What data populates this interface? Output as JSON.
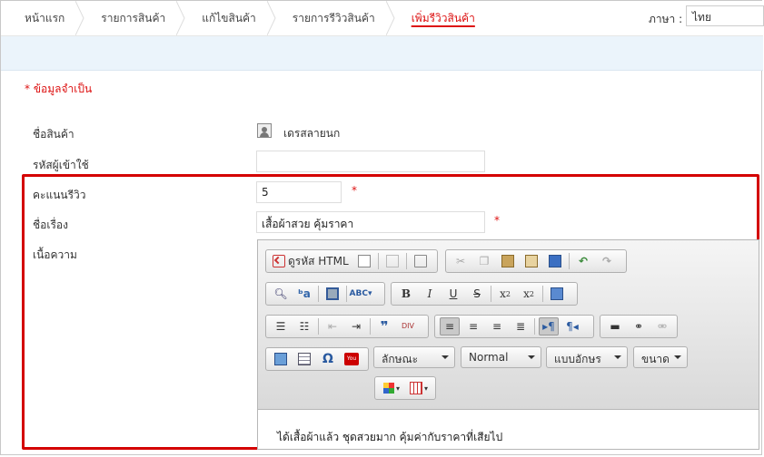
{
  "breadcrumb": [
    "หน้าแรก",
    "รายการสินค้า",
    "แก้ไขสินค้า",
    "รายการรีวิวสินค้า",
    "เพิ่มรีวิวสินค้า"
  ],
  "language": {
    "label": "ภาษา :",
    "value": "ไทย"
  },
  "required_note": "* ข้อมูลจำเป็น",
  "form": {
    "product_label": "ชื่อสินค้า",
    "product_value": "เดรสลายนก",
    "user_label": "รหัสผู้เข้าใช้",
    "user_value": "",
    "score_label": "คะแนนรีวิว",
    "score_value": "5",
    "title_label": "ชื่อเรื่อง",
    "title_value": "เสื้อผ้าสวย คุ้มราคา",
    "content_label": "เนื้อความ",
    "required_mark": "*"
  },
  "editor": {
    "source_label": "ดูรหัส HTML",
    "style_combo": "ลักษณะ",
    "format_combo": "Normal",
    "font_combo": "แบบอักษร",
    "size_combo": "ขนาด",
    "content": "ได้เสื้อผ้าแล้ว ชุดสวยมาก คุ้มค่ากับราคาที่เสียไป"
  },
  "colors": {
    "highlight": "#d40000",
    "lang_bar": "#ebf4fb"
  }
}
